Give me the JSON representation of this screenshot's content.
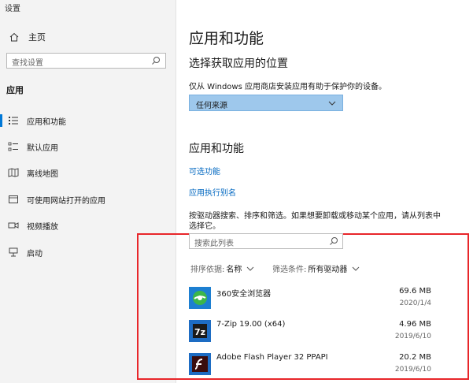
{
  "window": {
    "title": "设置"
  },
  "sidebar": {
    "home_label": "主页",
    "search_placeholder": "查找设置",
    "section_title": "应用",
    "items": [
      {
        "label": "应用和功能",
        "icon": "apps-features-icon",
        "selected": true
      },
      {
        "label": "默认应用",
        "icon": "default-apps-icon"
      },
      {
        "label": "离线地图",
        "icon": "offline-maps-icon"
      },
      {
        "label": "可使用网站打开的应用",
        "icon": "apps-for-websites-icon"
      },
      {
        "label": "视频播放",
        "icon": "video-playback-icon"
      },
      {
        "label": "启动",
        "icon": "startup-icon"
      }
    ]
  },
  "main": {
    "title": "应用和功能",
    "install_section": {
      "heading": "选择获取应用的位置",
      "description": "仅从 Windows 应用商店安装应用有助于保护你的设备。",
      "dropdown_value": "任何来源"
    },
    "apps_section": {
      "heading": "应用和功能",
      "link_optional": "可选功能",
      "link_aliases": "应用执行别名",
      "description_line1": "按驱动器搜索、排序和筛选。如果想要卸载或移动某个应用，请从列表中",
      "description_line2": "选择它。",
      "search_placeholder": "搜索此列表",
      "sort_label": "排序依据:",
      "sort_value": "名称",
      "filter_label": "筛选条件:",
      "filter_value": "所有驱动器"
    },
    "apps": [
      {
        "name": "360安全浏览器",
        "size": "69.6 MB",
        "date": "2020/1/4",
        "icon": "360-browser-icon"
      },
      {
        "name": "7-Zip 19.00 (x64)",
        "size": "4.96 MB",
        "date": "2019/6/10",
        "icon": "7zip-icon"
      },
      {
        "name": "Adobe Flash Player 32 PPAPI",
        "size": "20.2 MB",
        "date": "2019/6/10",
        "icon": "flash-player-icon"
      }
    ]
  },
  "colors": {
    "accent": "#0078d7",
    "dropdown_bg": "#9ec8ec",
    "link": "#0067c0",
    "highlight": "#e8262a"
  }
}
